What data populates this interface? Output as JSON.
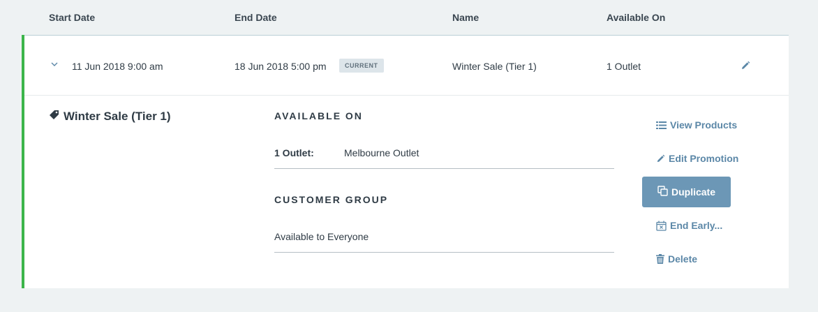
{
  "table": {
    "headers": {
      "start_date": "Start Date",
      "end_date": "End Date",
      "name": "Name",
      "available_on": "Available On"
    }
  },
  "promotion": {
    "start": "11 Jun 2018 9:00 am",
    "end": "18 Jun 2018 5:00 pm",
    "status_badge": "CURRENT",
    "name": "Winter Sale (Tier 1)",
    "available_on": "1 Outlet"
  },
  "detail": {
    "title": "Winter Sale (Tier 1)",
    "available_on_heading": "AVAILABLE ON",
    "outlet_label": "1 Outlet:",
    "outlet_value": "Melbourne Outlet",
    "customer_group_heading": "CUSTOMER GROUP",
    "customer_group_value": "Available to Everyone"
  },
  "actions": {
    "view_products": "View Products",
    "edit_promotion": "Edit Promotion",
    "duplicate": "Duplicate",
    "end_early": "End Early...",
    "delete": "Delete"
  },
  "colors": {
    "accent_green": "#3cb54a",
    "link_blue": "#5b87a7",
    "button_blue": "#6c97b6",
    "page_bg": "#eef2f3"
  },
  "icons": {
    "expand": "chevron-down-icon",
    "edit_row": "pencil-icon",
    "tag": "tag-icon",
    "view_products": "list-icon",
    "edit_promotion": "pencil-icon",
    "duplicate": "copy-icon",
    "end_early": "calendar-x-icon",
    "delete": "trash-icon"
  }
}
